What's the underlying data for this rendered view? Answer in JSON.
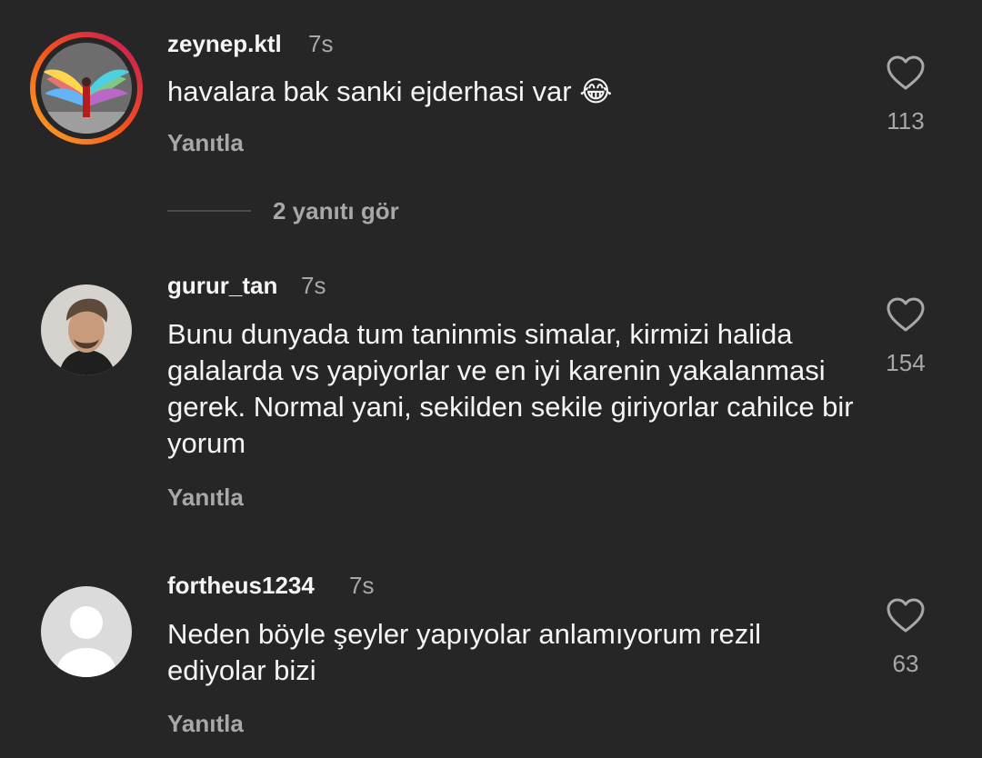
{
  "comments": [
    {
      "username": "zeynep.ktl",
      "time": "7s",
      "text": "havalara bak sanki ejderhasi var",
      "emoji": "😂",
      "reply_label": "Yanıtla",
      "likes": "113",
      "avatar": "story-ring-avatar"
    },
    {
      "username": "gurur_tan",
      "time": "7s",
      "text": "Bunu dunyada tum taninmis simalar, kirmizi halida galalarda vs yapiyorlar ve en iyi karenin yakalanmasi gerek. Normal yani, sekilden sekile giriyorlar cahilce bir yorum",
      "reply_label": "Yanıtla",
      "likes": "154",
      "avatar": "photo-avatar"
    },
    {
      "username": "fortheus1234",
      "time": "7s",
      "text": "Neden böyle şeyler yapıyolar anlamıyorum rezil ediyolar bizi",
      "reply_label": "Yanıtla",
      "likes": "63",
      "avatar": "default-avatar"
    }
  ],
  "view_replies_label": "2 yanıtı gör",
  "colors": {
    "background": "#262626",
    "primary_text": "#f5f5f5",
    "secondary_text": "#a8a8a8"
  }
}
